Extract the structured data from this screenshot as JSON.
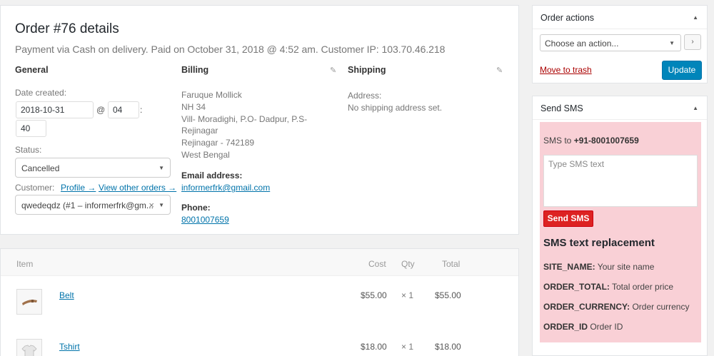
{
  "order": {
    "title": "Order #76 details",
    "meta": "Payment via Cash on delivery. Paid on October 31, 2018 @ 4:52 am. Customer IP: 103.70.46.218"
  },
  "general": {
    "heading": "General",
    "date_label": "Date created:",
    "date_value": "2018-10-31",
    "at_sign": "@",
    "hour_value": "04",
    "colon": ":",
    "minute_value": "40",
    "status_label": "Status:",
    "status_value": "Cancelled",
    "customer_label": "Customer:",
    "profile_link": "Profile →",
    "other_orders_link": "View other orders →",
    "customer_value": "qwedeqdz (#1 – informerfrk@gm...",
    "clear_glyph": "×"
  },
  "billing": {
    "heading": "Billing",
    "address_lines": [
      "Faruque Mollick",
      "NH 34",
      "Vill- Moradighi, P.O- Dadpur, P.S-",
      "Rejinagar",
      "Rejinagar - 742189",
      "West Bengal"
    ],
    "email_label": "Email address:",
    "email_value": "informerfrk@gmail.com",
    "phone_label": "Phone:",
    "phone_value": "8001007659"
  },
  "shipping": {
    "heading": "Shipping",
    "address_label": "Address:",
    "address_value": "No shipping address set."
  },
  "items": {
    "columns": {
      "item": "Item",
      "cost": "Cost",
      "qty": "Qty",
      "total": "Total"
    },
    "rows": [
      {
        "name": "Belt",
        "cost": "$55.00",
        "qty": "× 1",
        "total": "$55.00",
        "thumb_icon": "belt-icon"
      },
      {
        "name": "Tshirt",
        "cost": "$18.00",
        "qty": "× 1",
        "total": "$18.00",
        "thumb_icon": "tshirt-icon"
      }
    ]
  },
  "order_actions": {
    "title": "Order actions",
    "select_value": "Choose an action...",
    "go_glyph": "›",
    "trash_link": "Move to trash",
    "update_button": "Update"
  },
  "send_sms": {
    "title": "Send SMS",
    "to_label": "SMS to ",
    "to_number": "+91-8001007659",
    "placeholder": "Type SMS text",
    "send_button": "Send SMS",
    "replacement_heading": "SMS text replacement",
    "replacements": [
      {
        "key": "SITE_NAME:",
        "desc": " Your site name"
      },
      {
        "key": "ORDER_TOTAL:",
        "desc": " Total order price"
      },
      {
        "key": "ORDER_CURRENCY:",
        "desc": " Order currency"
      },
      {
        "key": "ORDER_ID",
        "desc": " Order ID"
      }
    ]
  },
  "colors": {
    "accent": "#0085ba",
    "sms_background": "#f9d0d6",
    "sms_button": "#dd2222",
    "trash": "#aa0000"
  }
}
